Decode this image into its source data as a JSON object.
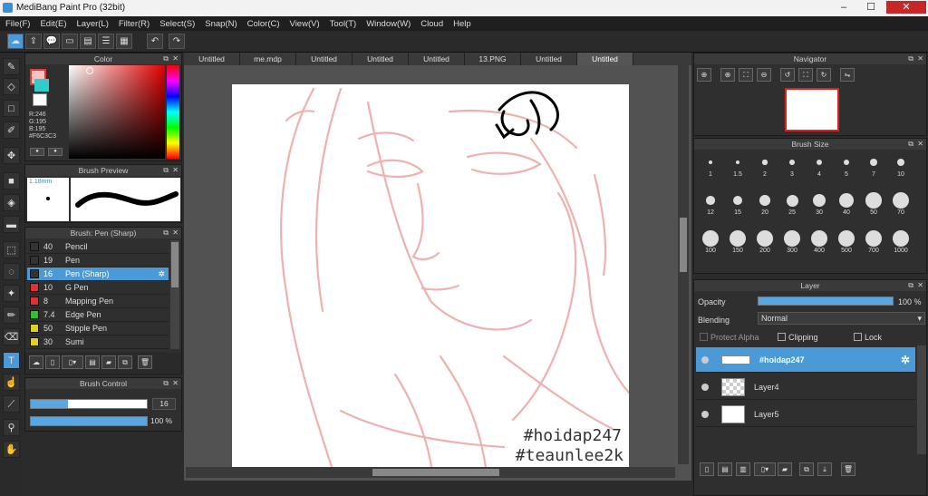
{
  "window": {
    "title": "MediBang Paint Pro (32bit)",
    "min": "–",
    "max": "☐",
    "close": "✕"
  },
  "menu": [
    "File(F)",
    "Edit(E)",
    "Layer(L)",
    "Filter(R)",
    "Select(S)",
    "Snap(N)",
    "Color(C)",
    "View(V)",
    "Tool(T)",
    "Window(W)",
    "Cloud",
    "Help"
  ],
  "toolbar": {
    "icons": [
      "cloud-icon",
      "export-icon",
      "comment-icon",
      "chat-icon",
      "document-icon",
      "list-icon",
      "grid-icon",
      "undo-icon",
      "redo-icon"
    ]
  },
  "color_panel": {
    "title": "Color",
    "r": "R:246",
    "g": "G:195",
    "b": "B:195",
    "hex": "#F6C3C3",
    "accent": "#F6C3C3"
  },
  "brush_preview": {
    "title": "Brush Preview",
    "size": "1.18mm"
  },
  "brush_list": {
    "title": "Brush: Pen (Sharp)",
    "items": [
      {
        "size": "40",
        "name": "Pencil",
        "color": "#333333"
      },
      {
        "size": "19",
        "name": "Pen",
        "color": "#333333"
      },
      {
        "size": "16",
        "name": "Pen (Sharp)",
        "color": "#333333"
      },
      {
        "size": "10",
        "name": "G Pen",
        "color": "#e03030"
      },
      {
        "size": "8",
        "name": "Mapping Pen",
        "color": "#e03030"
      },
      {
        "size": "7.4",
        "name": "Edge Pen",
        "color": "#30c030"
      },
      {
        "size": "50",
        "name": "Stipple Pen",
        "color": "#e0d020"
      },
      {
        "size": "30",
        "name": "Sumi",
        "color": "#e0d020"
      }
    ]
  },
  "brush_control": {
    "title": "Brush Control",
    "size_value": "16",
    "opacity_value": "100 %",
    "size_fraction": 0.32,
    "opacity_fraction": 1.0
  },
  "tabs": [
    "Untitled",
    "me.mdp",
    "Untitled",
    "Untitled",
    "Untitled",
    "13.PNG",
    "Untitled",
    "Untitled"
  ],
  "canvas": {
    "watermark1": "#hoidap247",
    "watermark2": "#teaunlee2k"
  },
  "navigator": {
    "title": "Navigator"
  },
  "brush_size": {
    "title": "Brush Size",
    "sizes": [
      "1",
      "1.5",
      "2",
      "3",
      "4",
      "5",
      "7",
      "10",
      "12",
      "15",
      "20",
      "25",
      "30",
      "40",
      "50",
      "70",
      "100",
      "150",
      "200",
      "300",
      "400",
      "500",
      "700",
      "1000"
    ]
  },
  "layer_panel": {
    "title": "Layer",
    "opacity_label": "Opacity",
    "opacity_value": "100 %",
    "blending_label": "Blending",
    "blending_value": "Normal",
    "protect_alpha": "Protect Alpha",
    "clipping": "Clipping",
    "lock": "Lock",
    "layers": [
      {
        "name": "#hoidap247"
      },
      {
        "name": "Layer4"
      },
      {
        "name": "Layer5"
      }
    ]
  }
}
